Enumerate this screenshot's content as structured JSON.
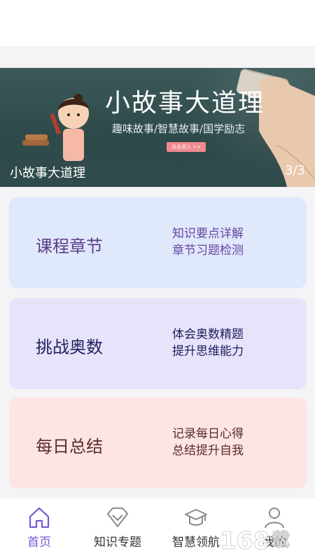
{
  "banner": {
    "title": "小故事大道理",
    "subtitle": "趣味故事/智慧故事/国学励志",
    "enter_label": "点击进入 >>",
    "caption": "小故事大道理",
    "page_indicator": "3/3"
  },
  "cards": [
    {
      "title": "课程章节",
      "line1": "知识要点详解",
      "line2": "章节习题检测"
    },
    {
      "title": "挑战奥数",
      "line1": "体会奥数精题",
      "line2": "提升思维能力"
    },
    {
      "title": "每日总结",
      "line1": "记录每日心得",
      "line2": "总结提升自我"
    }
  ],
  "tabs": [
    {
      "label": "首页",
      "icon": "home-icon"
    },
    {
      "label": "知识专题",
      "icon": "diamond-icon"
    },
    {
      "label": "智慧领航",
      "icon": "graduation-cap-icon"
    },
    {
      "label": "我的",
      "icon": "user-icon"
    }
  ],
  "colors": {
    "accent": "#7a55d6",
    "card1_bg": "#dfe9fb",
    "card2_bg": "#e6e3fa",
    "card3_bg": "#fde5e3"
  }
}
